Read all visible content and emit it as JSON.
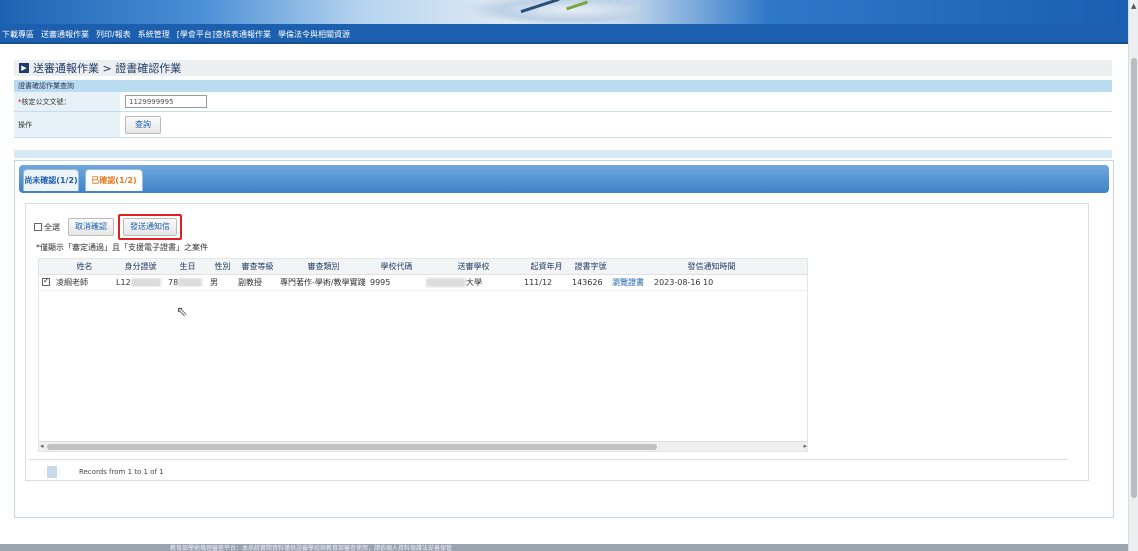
{
  "topnav": {
    "items": [
      "下載專區",
      "送審通報作業",
      "列印/報表",
      "系統管理",
      "[學會平台]查核表通報作業",
      "學倫法令與相關資源"
    ]
  },
  "breadcrumb": {
    "text": "送審通報作業 > 證書確認作業"
  },
  "query": {
    "header": "證書確認作業查詢",
    "doc_label_req": "*",
    "doc_label": "核定公文文號：",
    "doc_value": "1129999995",
    "action_label": "操作",
    "query_button": "查詢"
  },
  "tabs": {
    "unconfirmed": "尚未確認(1/2)",
    "confirmed": "已確認(1/2)"
  },
  "toolbar": {
    "select_all": "全選",
    "cancel_confirm": "取消確認",
    "send_notice": "發送通知信"
  },
  "note": "*僅顯示「審定通過」且「支援電子證書」之案件",
  "grid": {
    "headers": [
      "",
      "姓名",
      "身分證號",
      "生日",
      "性別",
      "審查等級",
      "審查類別",
      "學校代碼",
      "送審學校",
      "起資年月",
      "證書字號",
      "",
      "發信通知時間"
    ],
    "row": {
      "name": "凌綱老師",
      "id_prefix": "L12",
      "birth": "78",
      "gender": "男",
      "level": "副教授",
      "category": "專門著作-學術/教學實踐",
      "school_code": "9995",
      "school": "大學",
      "start": "111/12",
      "cert_no": "143626",
      "view": "瀏覽證書",
      "sent_time": "2023-08-16 10"
    }
  },
  "pager": {
    "text": "Records from 1 to 1 of 1"
  },
  "footer": {
    "text": "教育部學術倫理審查平台：本系統實際資料僅供送審學校與教育部審查使用，請依個人資料保護法妥善保管"
  },
  "colors": {
    "nav": "#1b5fae",
    "tab_active_text": "#e07a1f",
    "highlight_border": "#e02020"
  }
}
